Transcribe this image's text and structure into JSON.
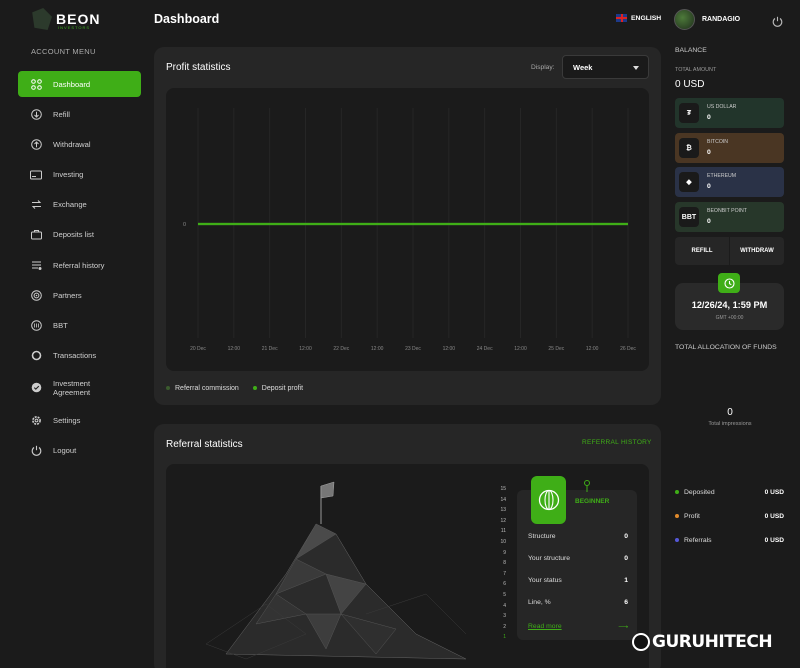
{
  "brand": {
    "name": "BEON",
    "tagline": "INVESTORS"
  },
  "header": {
    "title": "Dashboard",
    "language": "ENGLISH",
    "username": "RANDAGIO"
  },
  "sidebar": {
    "section_label": "ACCOUNT MENU",
    "items": [
      {
        "label": "Dashboard",
        "icon": "grid-icon"
      },
      {
        "label": "Refill",
        "icon": "download-icon"
      },
      {
        "label": "Withdrawal",
        "icon": "upload-icon"
      },
      {
        "label": "Investing",
        "icon": "card-icon"
      },
      {
        "label": "Exchange",
        "icon": "swap-icon"
      },
      {
        "label": "Deposits list",
        "icon": "briefcase-icon"
      },
      {
        "label": "Referral history",
        "icon": "list-icon"
      },
      {
        "label": "Partners",
        "icon": "target-icon"
      },
      {
        "label": "BBT",
        "icon": "coin-icon"
      },
      {
        "label": "Transactions",
        "icon": "ring-icon"
      },
      {
        "label": "Investment Agreement",
        "icon": "badge-icon"
      },
      {
        "label": "Settings",
        "icon": "gear-icon"
      },
      {
        "label": "Logout",
        "icon": "power-icon"
      }
    ]
  },
  "profit": {
    "title": "Profit statistics",
    "display_label": "Display:",
    "display_value": "Week",
    "legend": [
      {
        "name": "Referral commission",
        "color": "#3b5b2e"
      },
      {
        "name": "Deposit profit",
        "color": "#3fae17"
      }
    ]
  },
  "chart_data": {
    "type": "line",
    "x": [
      "20 Dec",
      "12:00",
      "21 Dec",
      "12:00",
      "22 Dec",
      "12:00",
      "23 Dec",
      "12:00",
      "24 Dec",
      "12:00",
      "25 Dec",
      "12:00",
      "26 Dec"
    ],
    "y_ticks": [
      "0"
    ],
    "series": [
      {
        "name": "Deposit profit",
        "color": "#3fae17",
        "values": [
          0,
          0,
          0,
          0,
          0,
          0,
          0,
          0,
          0,
          0,
          0,
          0,
          0
        ]
      },
      {
        "name": "Referral commission",
        "color": "#3b5b2e",
        "values": [
          0,
          0,
          0,
          0,
          0,
          0,
          0,
          0,
          0,
          0,
          0,
          0,
          0
        ]
      }
    ],
    "grid": true
  },
  "referral": {
    "title": "Referral statistics",
    "history_link": "REFERRAL HISTORY",
    "levels": [
      "15",
      "14",
      "13",
      "12",
      "11",
      "10",
      "9",
      "8",
      "7",
      "6",
      "5",
      "4",
      "3",
      "2",
      "1"
    ],
    "rank": "BEGINNER",
    "rows": [
      {
        "label": "Structure",
        "value": "0"
      },
      {
        "label": "Your structure",
        "value": "0"
      },
      {
        "label": "Your status",
        "value": "1"
      },
      {
        "label": "Line, %",
        "value": "6"
      }
    ],
    "read_more": "Read more",
    "read_more_arrow": "⟶"
  },
  "balance": {
    "title": "BALANCE",
    "total_label": "TOTAL AMOUNT",
    "total_value": "0 USD",
    "wallets": [
      {
        "name": "US DOLLAR",
        "value": "0",
        "symbol": "₮",
        "bg": "#22352b"
      },
      {
        "name": "BITCOIN",
        "value": "0",
        "symbol": "₿",
        "bg": "#4a3623"
      },
      {
        "name": "ETHEREUM",
        "value": "0",
        "symbol": "◆",
        "bg": "#2a3247"
      },
      {
        "name": "BEONBIT POINT",
        "value": "0",
        "symbol": "BBT",
        "bg": "#27372a"
      }
    ],
    "refill": "REFILL",
    "withdraw": "WITHDRAW"
  },
  "clock": {
    "time": "12/26/24, 1:59 PM",
    "timezone": "GMT +00:00"
  },
  "allocation": {
    "title": "TOTAL ALLOCATION OF FUNDS",
    "impressions_value": "0",
    "impressions_label": "Total impressions",
    "rows": [
      {
        "label": "Deposited",
        "value": "0 USD",
        "color": "#3fae17"
      },
      {
        "label": "Profit",
        "value": "0 USD",
        "color": "#e08a2c"
      },
      {
        "label": "Referrals",
        "value": "0 USD",
        "color": "#5558d8"
      }
    ]
  },
  "watermark": "GURUHITECH"
}
